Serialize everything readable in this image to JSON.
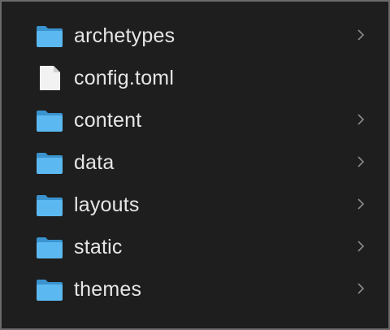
{
  "items": [
    {
      "name": "archetypes",
      "kind": "folder",
      "icon": "folder-icon",
      "has_children": true
    },
    {
      "name": "config.toml",
      "kind": "file",
      "icon": "document-icon",
      "has_children": false
    },
    {
      "name": "content",
      "kind": "folder",
      "icon": "folder-icon",
      "has_children": true
    },
    {
      "name": "data",
      "kind": "folder",
      "icon": "folder-icon",
      "has_children": true
    },
    {
      "name": "layouts",
      "kind": "folder",
      "icon": "folder-icon",
      "has_children": true
    },
    {
      "name": "static",
      "kind": "folder",
      "icon": "folder-icon",
      "has_children": true
    },
    {
      "name": "themes",
      "kind": "folder",
      "icon": "folder-icon",
      "has_children": true
    }
  ],
  "colors": {
    "background": "#1e1e1e",
    "text": "#e6e6e6",
    "folder_front": "#5bb8f0",
    "folder_back": "#3a93cf",
    "document": "#f2f2f2",
    "chevron": "#8a8a8a"
  }
}
